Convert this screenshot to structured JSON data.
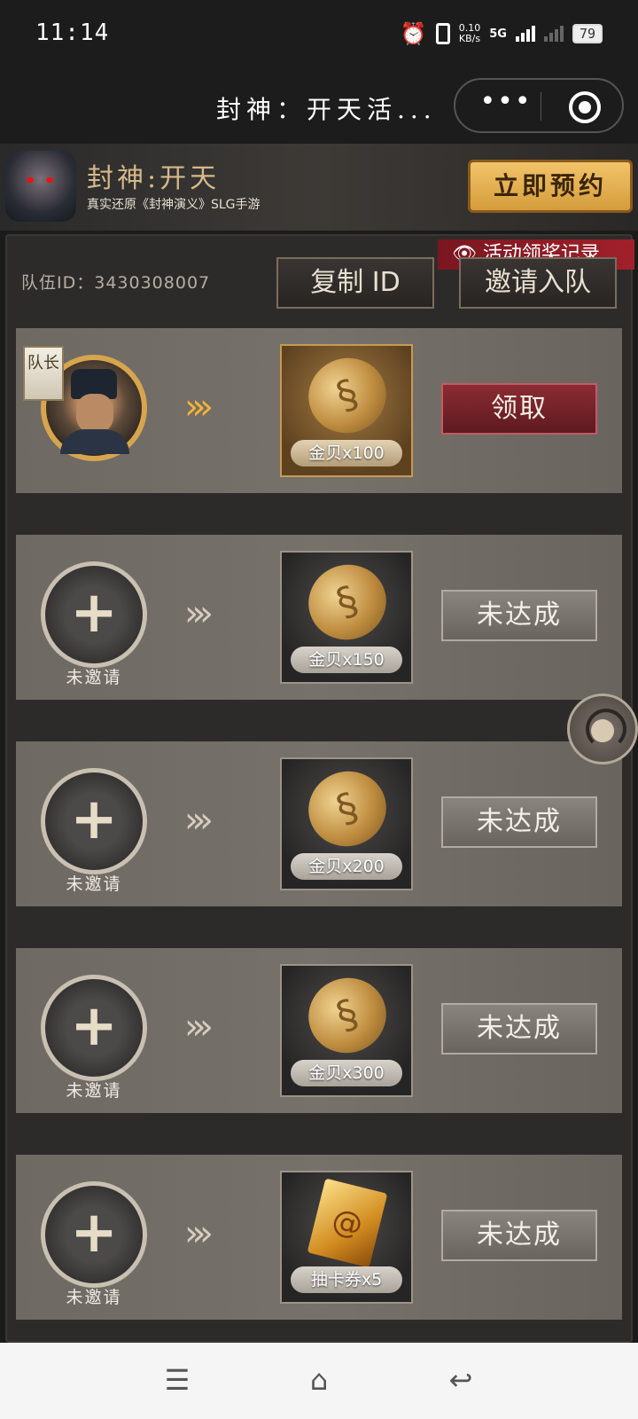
{
  "status_bar": {
    "time": "11:14",
    "net_speed_value": "0.10",
    "net_speed_unit": "KB/s",
    "network": "5G",
    "battery": "79"
  },
  "nav": {
    "title": "封神：开天活...",
    "more_icon": "•••"
  },
  "banner": {
    "title": "封神:开天",
    "subtitle": "真实还原《封神演义》SLG手游",
    "reserve_label": "立即预约"
  },
  "team": {
    "record_label": "👁 活动领奖记录",
    "team_id": "队伍ID：3430308007",
    "copy_label": "复制 ID",
    "invite_label": "邀请入队"
  },
  "rows": [
    {
      "leader_tag": "队长",
      "label": "",
      "reward": "金贝x100",
      "status": "领取",
      "arrows": "»»"
    },
    {
      "label": "未邀请",
      "reward": "金贝x150",
      "status": "未达成",
      "arrows": "»»",
      "plus": "+"
    },
    {
      "label": "未邀请",
      "reward": "金贝x200",
      "status": "未达成",
      "arrows": "»»",
      "plus": "+"
    },
    {
      "label": "未邀请",
      "reward": "金贝x300",
      "status": "未达成",
      "arrows": "»»",
      "plus": "+"
    },
    {
      "label": "未邀请",
      "reward": "抽卡券x5",
      "status": "未达成",
      "arrows": "»»",
      "plus": "+"
    }
  ],
  "bottom_nav": {
    "menu_icon": "☰",
    "home_icon": "⌂",
    "back_icon": "↩"
  },
  "colors": {
    "background": "#1b1b1b",
    "gold_accent": "#d49c3b",
    "claim_red": "#8b2b33",
    "record_red": "#a1202a"
  }
}
